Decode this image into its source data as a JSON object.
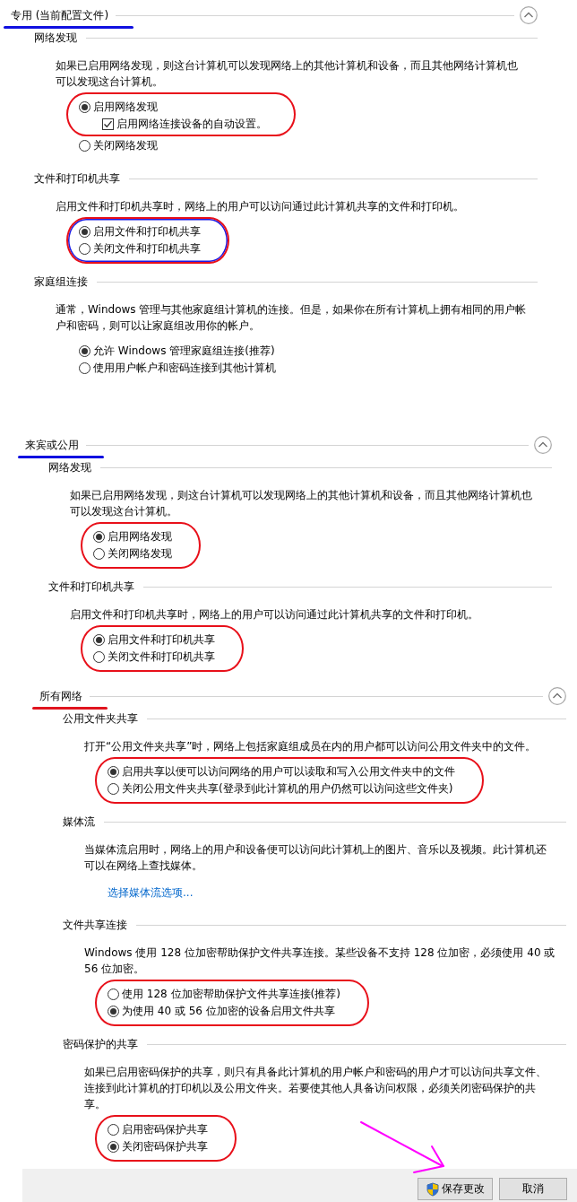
{
  "sections": [
    {
      "title": "专用 (当前配置文件)",
      "underline": {
        "color": "#1010e0"
      },
      "expanded": true,
      "groups": [
        {
          "heading": "网络发现",
          "description": "如果已启用网络发现，则这台计算机可以发现网络上的其他计算机和设备，而且其他网络计算机也可以发现这台计算机。",
          "double_ring": false,
          "options": [
            {
              "label": "启用网络发现",
              "selected": true,
              "circled": true,
              "children": [
                {
                  "label": "启用网络连接设备的自动设置。",
                  "checked": true
                }
              ]
            },
            {
              "label": "关闭网络发现",
              "selected": false,
              "circled": false
            }
          ]
        },
        {
          "heading": "文件和打印机共享",
          "description": "启用文件和打印机共享时，网络上的用户可以访问通过此计算机共享的文件和打印机。",
          "double_ring": true,
          "options": [
            {
              "label": "启用文件和打印机共享",
              "selected": true,
              "circled": true
            },
            {
              "label": "关闭文件和打印机共享",
              "selected": false,
              "circled": true
            }
          ]
        },
        {
          "heading": "家庭组连接",
          "description": "通常，Windows 管理与其他家庭组计算机的连接。但是，如果你在所有计算机上拥有相同的用户帐户和密码，则可以让家庭组改用你的帐户。",
          "options": [
            {
              "label": "允许 Windows 管理家庭组连接(推荐)",
              "selected": true,
              "circled": false
            },
            {
              "label": "使用用户帐户和密码连接到其他计算机",
              "selected": false,
              "circled": false
            }
          ]
        }
      ]
    },
    {
      "title": "来宾或公用",
      "underline": {
        "color": "#1010e0"
      },
      "expanded": true,
      "groups": [
        {
          "heading": "网络发现",
          "description": "如果已启用网络发现，则这台计算机可以发现网络上的其他计算机和设备，而且其他网络计算机也可以发现这台计算机。",
          "double_ring": false,
          "options": [
            {
              "label": "启用网络发现",
              "selected": true,
              "circled": true
            },
            {
              "label": "关闭网络发现",
              "selected": false,
              "circled": true
            }
          ]
        },
        {
          "heading": "文件和打印机共享",
          "description": "启用文件和打印机共享时，网络上的用户可以访问通过此计算机共享的文件和打印机。",
          "double_ring": false,
          "options": [
            {
              "label": "启用文件和打印机共享",
              "selected": true,
              "circled": true
            },
            {
              "label": "关闭文件和打印机共享",
              "selected": false,
              "circled": true
            }
          ]
        }
      ]
    },
    {
      "title": "所有网络",
      "underline": {
        "color": "#e0141e"
      },
      "expanded": true,
      "groups": [
        {
          "heading": "公用文件夹共享",
          "description": "打开“公用文件夹共享”时，网络上包括家庭组成员在内的用户都可以访问公用文件夹中的文件。",
          "double_ring": false,
          "options": [
            {
              "label": "启用共享以便可以访问网络的用户可以读取和写入公用文件夹中的文件",
              "selected": true,
              "circled": true
            },
            {
              "label": "关闭公用文件夹共享(登录到此计算机的用户仍然可以访问这些文件夹)",
              "selected": false,
              "circled": true
            }
          ]
        },
        {
          "heading": "媒体流",
          "description": "当媒体流启用时，网络上的用户和设备便可以访问此计算机上的图片、音乐以及视频。此计算机还可以在网络上查找媒体。",
          "link": "选择媒体流选项..."
        },
        {
          "heading": "文件共享连接",
          "description": "Windows 使用 128 位加密帮助保护文件共享连接。某些设备不支持 128 位加密，必须使用 40 或 56 位加密。",
          "double_ring": false,
          "options": [
            {
              "label": "使用 128 位加密帮助保护文件共享连接(推荐)",
              "selected": false,
              "circled": true
            },
            {
              "label": "为使用 40 或 56 位加密的设备启用文件共享",
              "selected": true,
              "circled": true
            }
          ]
        },
        {
          "heading": "密码保护的共享",
          "description": "如果已启用密码保护的共享，则只有具备此计算机的用户帐户和密码的用户才可以访问共享文件、连接到此计算机的打印机以及公用文件夹。若要使其他人具备访问权限，必须关闭密码保护的共享。",
          "double_ring": false,
          "options": [
            {
              "label": "启用密码保护共享",
              "selected": false,
              "circled": true
            },
            {
              "label": "关闭密码保护共享",
              "selected": true,
              "circled": true
            }
          ]
        }
      ]
    }
  ],
  "footer": {
    "arrow_annotation": true,
    "buttons": [
      {
        "label": "保存更改",
        "kind": "save"
      },
      {
        "label": "取消",
        "kind": "cancel"
      }
    ]
  }
}
